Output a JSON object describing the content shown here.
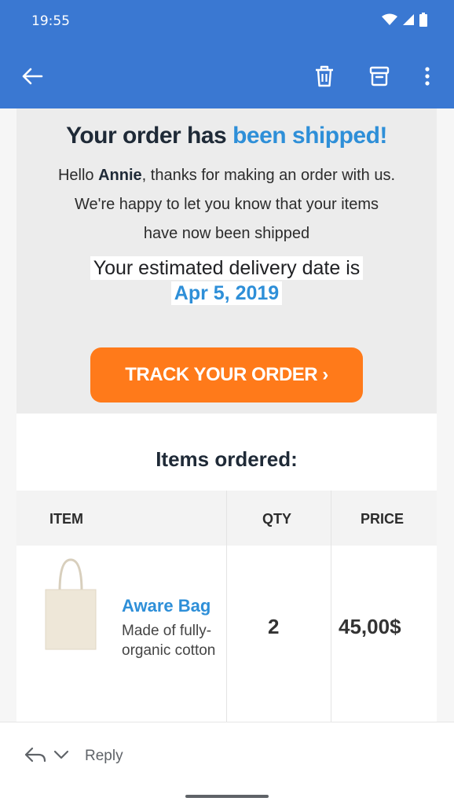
{
  "status_bar": {
    "time": "19:55"
  },
  "app_bar": {
    "back_icon": "arrow-left-icon",
    "delete_icon": "trash-icon",
    "archive_icon": "archive-icon",
    "more_icon": "more-vert-icon"
  },
  "email": {
    "title_part1": "Your order has ",
    "title_part2": "been shipped!",
    "greeting_prefix": "Hello ",
    "customer_name": "Annie",
    "greeting_suffix": ", thanks for making an order with us. We're happy to let you know that your items have now been shipped",
    "eta_label": "Your estimated delivery date is",
    "eta_date": "Apr 5, 2019",
    "track_button": "TRACK YOUR ORDER ›",
    "items_title": "Items ordered:",
    "table": {
      "headers": [
        "ITEM",
        "QTY",
        "PRICE"
      ],
      "rows": [
        {
          "name": "Aware Bag",
          "description": "Made of fully-organic cotton",
          "qty": "2",
          "price": "45,00$"
        }
      ]
    }
  },
  "reply_bar": {
    "reply_label": "Reply"
  },
  "colors": {
    "accent": "#3a78d2",
    "link": "#2e8fd8",
    "cta": "#ff7a1a"
  }
}
